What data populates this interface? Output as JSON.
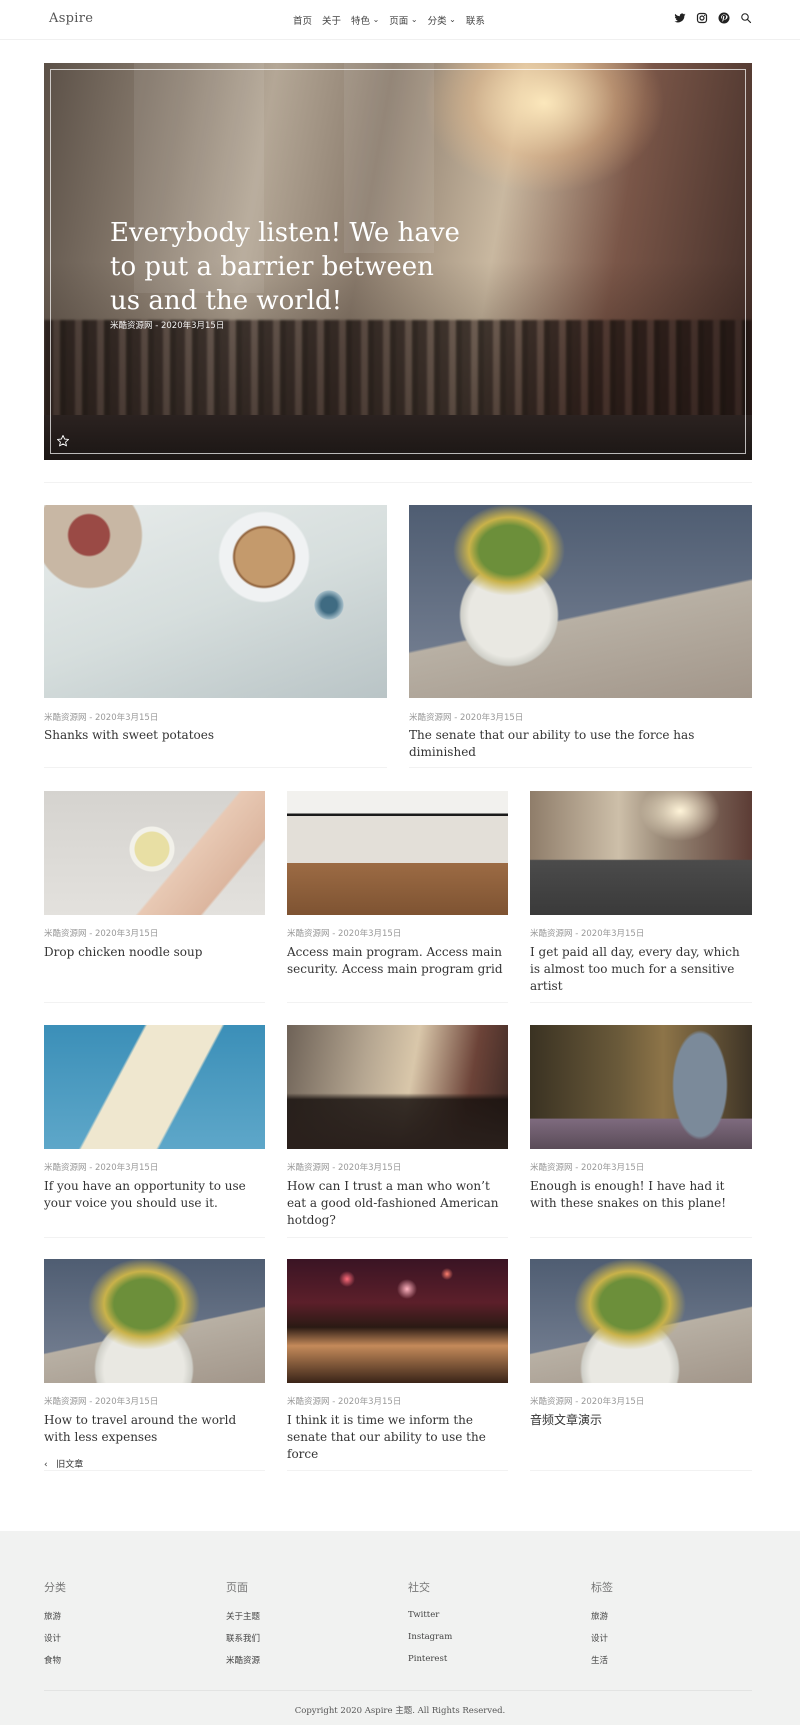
{
  "header": {
    "logo": "Aspire",
    "nav": [
      {
        "label": "首页",
        "dropdown": false
      },
      {
        "label": "关于",
        "dropdown": false
      },
      {
        "label": "特色",
        "dropdown": true
      },
      {
        "label": "页面",
        "dropdown": true
      },
      {
        "label": "分类",
        "dropdown": true
      },
      {
        "label": "联系",
        "dropdown": false
      }
    ],
    "social_icons": [
      "twitter-icon",
      "instagram-icon",
      "pinterest-icon",
      "search-icon"
    ]
  },
  "hero": {
    "title": "Everybody listen! We have to put a barrier between us and the world!",
    "meta": "米酷资源网 - 2020年3月15日",
    "icon": "star-icon"
  },
  "posts": [
    {
      "meta": "米酷资源网 - 2020年3月15日",
      "title": "Shanks with sweet potatoes"
    },
    {
      "meta": "米酷资源网 - 2020年3月15日",
      "title": "The senate that our ability to use the force has diminished"
    },
    {
      "meta": "米酷资源网 - 2020年3月15日",
      "title": "Drop chicken noodle soup"
    },
    {
      "meta": "米酷资源网 - 2020年3月15日",
      "title": "Access main program. Access main security. Access main program grid"
    },
    {
      "meta": "米酷资源网 - 2020年3月15日",
      "title": "I get paid all day, every day, which is almost too much for a sensitive artist"
    },
    {
      "meta": "米酷资源网 - 2020年3月15日",
      "title": "If you have an opportunity to use your voice you should use it."
    },
    {
      "meta": "米酷资源网 - 2020年3月15日",
      "title": "How can I trust a man who won’t eat a good old-fashioned American hotdog?"
    },
    {
      "meta": "米酷资源网 - 2020年3月15日",
      "title": "Enough is enough! I have had it with these snakes on this plane!"
    },
    {
      "meta": "米酷资源网 - 2020年3月15日",
      "title": "How to travel around the world with less expenses"
    },
    {
      "meta": "米酷资源网 - 2020年3月15日",
      "title": "I think it is time we inform the senate that our ability to use the force"
    },
    {
      "meta": "米酷资源网 - 2020年3月15日",
      "title": "音频文章演示"
    }
  ],
  "pagination": {
    "older_label": "旧文章"
  },
  "footer": {
    "columns": [
      {
        "heading": "分类",
        "items": [
          "旅游",
          "设计",
          "食物"
        ]
      },
      {
        "heading": "页面",
        "items": [
          "关于主题",
          "联系我们",
          "米酷资源"
        ]
      },
      {
        "heading": "社交",
        "items": [
          "Twitter",
          "Instagram",
          "Pinterest"
        ]
      },
      {
        "heading": "标签",
        "items": [
          "旅游",
          "设计",
          "生活"
        ]
      }
    ],
    "copyright": "Copyright 2020 Aspire 主题. All Rights Reserved."
  }
}
